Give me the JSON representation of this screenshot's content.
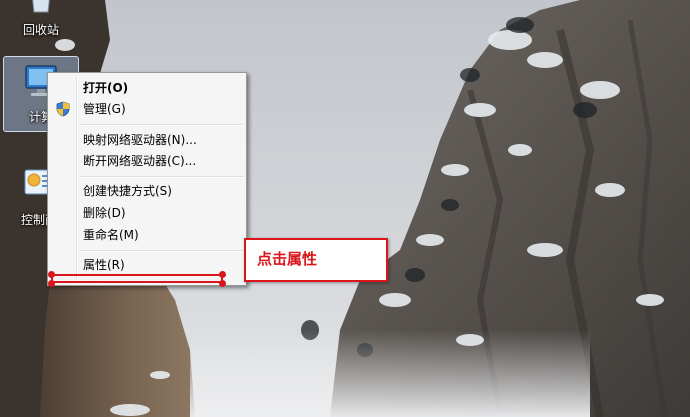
{
  "desktop": {
    "icons": [
      {
        "label": "回收站",
        "icon": "recycle-bin-icon"
      },
      {
        "label": "计算",
        "icon": "computer-icon"
      },
      {
        "label": "控制面",
        "icon": "control-panel-icon"
      }
    ]
  },
  "context_menu": {
    "items": [
      {
        "label": "打开(O)",
        "bold": true
      },
      {
        "label": "管理(G)",
        "icon": "uac-shield-icon"
      },
      {
        "label": "映射网络驱动器(N)..."
      },
      {
        "label": "断开网络驱动器(C)..."
      },
      {
        "label": "创建快捷方式(S)"
      },
      {
        "label": "删除(D)"
      },
      {
        "label": "重命名(M)"
      },
      {
        "label": "属性(R)"
      }
    ]
  },
  "annotation": {
    "callout_text": "点击属性",
    "color": "#d8161b"
  }
}
